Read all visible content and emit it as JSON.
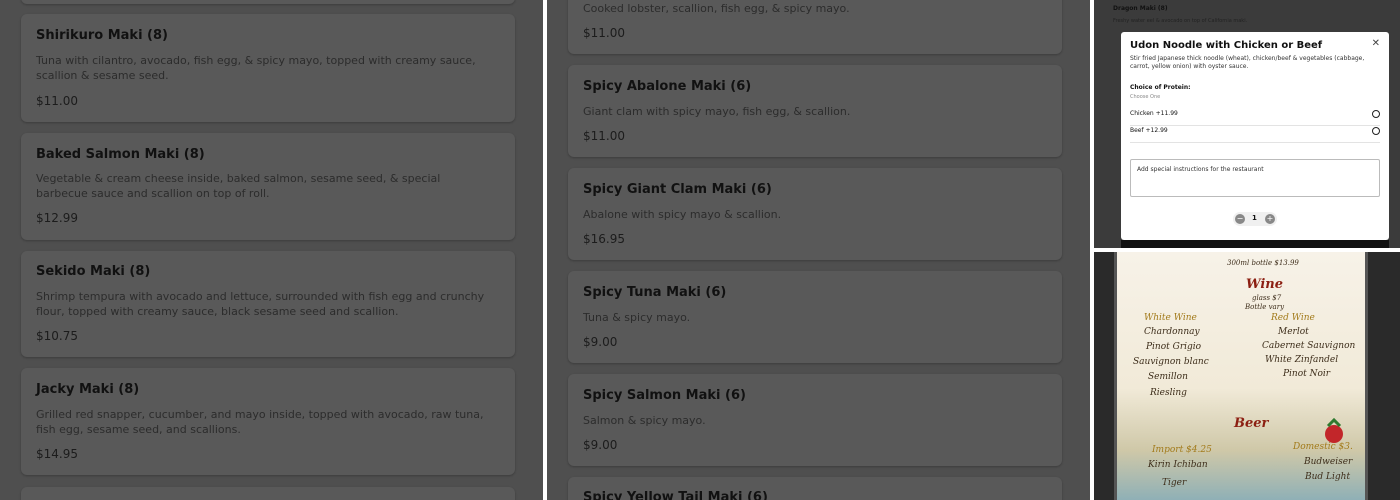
{
  "panel1": {
    "items": [
      {
        "title": "Shirikuro Maki (8)",
        "desc": "Tuna with cilantro, avocado, fish egg, & spicy mayo, topped with creamy sauce, scallion & sesame seed.",
        "price": "$11.00"
      },
      {
        "title": "Baked Salmon Maki (8)",
        "desc": "Vegetable & cream cheese inside, baked salmon, sesame seed, & special barbecue sauce and scallion on top of roll.",
        "price": "$12.99"
      },
      {
        "title": "Sekido Maki (8)",
        "desc": "Shrimp tempura with avocado and lettuce, surrounded with fish egg and crunchy flour, topped with creamy sauce, black sesame seed and scallion.",
        "price": "$10.75"
      },
      {
        "title": "Jacky Maki (8)",
        "desc": "Grilled red snapper, cucumber, and mayo inside, topped with avocado, raw tuna, fish egg, sesame seed, and scallions.",
        "price": "$14.95"
      }
    ]
  },
  "panel2": {
    "top_item": {
      "desc": "Cooked lobster, scallion, fish egg, & spicy mayo.",
      "price": "$11.00"
    },
    "items": [
      {
        "title": "Spicy Abalone Maki (6)",
        "desc": "Giant clam with spicy mayo, fish egg, & scallion.",
        "price": "$11.00"
      },
      {
        "title": "Spicy Giant Clam Maki (6)",
        "desc": "Abalone with spicy mayo & scallion.",
        "price": "$16.95"
      },
      {
        "title": "Spicy Tuna Maki (6)",
        "desc": "Tuna & spicy mayo.",
        "price": "$9.00"
      },
      {
        "title": "Spicy Salmon Maki (6)",
        "desc": "Salmon & spicy mayo.",
        "price": "$9.00"
      }
    ],
    "bottom_item": {
      "title": "Spicy Yellow Tail Maki (6)"
    }
  },
  "panel3": {
    "background": {
      "title": "Dragon Maki (8)",
      "desc": "Freshy water eel & avocado on top of California maki."
    },
    "modal": {
      "title": "Udon Noodle with Chicken or Beef",
      "close": "✕",
      "desc": "Stir fried Japanese thick noodle (wheat), chicken/beef & vegetables (cabbage, carrot, yellow onion) with oyster sauce.",
      "option_heading": "Choice of Protein:",
      "option_sub": "Choose One",
      "options": [
        "Chicken +11.99",
        "Beef +12.99"
      ],
      "instructions_placeholder": "Add special instructions for the restaurant",
      "quantity": "1",
      "minus": "−",
      "plus": "+"
    }
  },
  "panel4": {
    "top_line": "300ml bottle $13.99",
    "wine_heading": "Wine",
    "wine_price": "glass $7",
    "wine_note": "Bottle vary",
    "white_heading": "White Wine",
    "white": [
      "Chardonnay",
      "Pinot Grigio",
      "Sauvignon blanc",
      "Semillon",
      "Riesling"
    ],
    "red_heading": "Red Wine",
    "red": [
      "Merlot",
      "Cabernet Sauvignon",
      "White Zinfandel",
      "Pinot Noir"
    ],
    "beer_heading": "Beer",
    "import_heading": "Import $4.25",
    "import": [
      "Kirin Ichiban",
      "Tiger"
    ],
    "domestic_heading": "Domestic $3.",
    "domestic": [
      "Budweiser",
      "Bud Light"
    ]
  }
}
